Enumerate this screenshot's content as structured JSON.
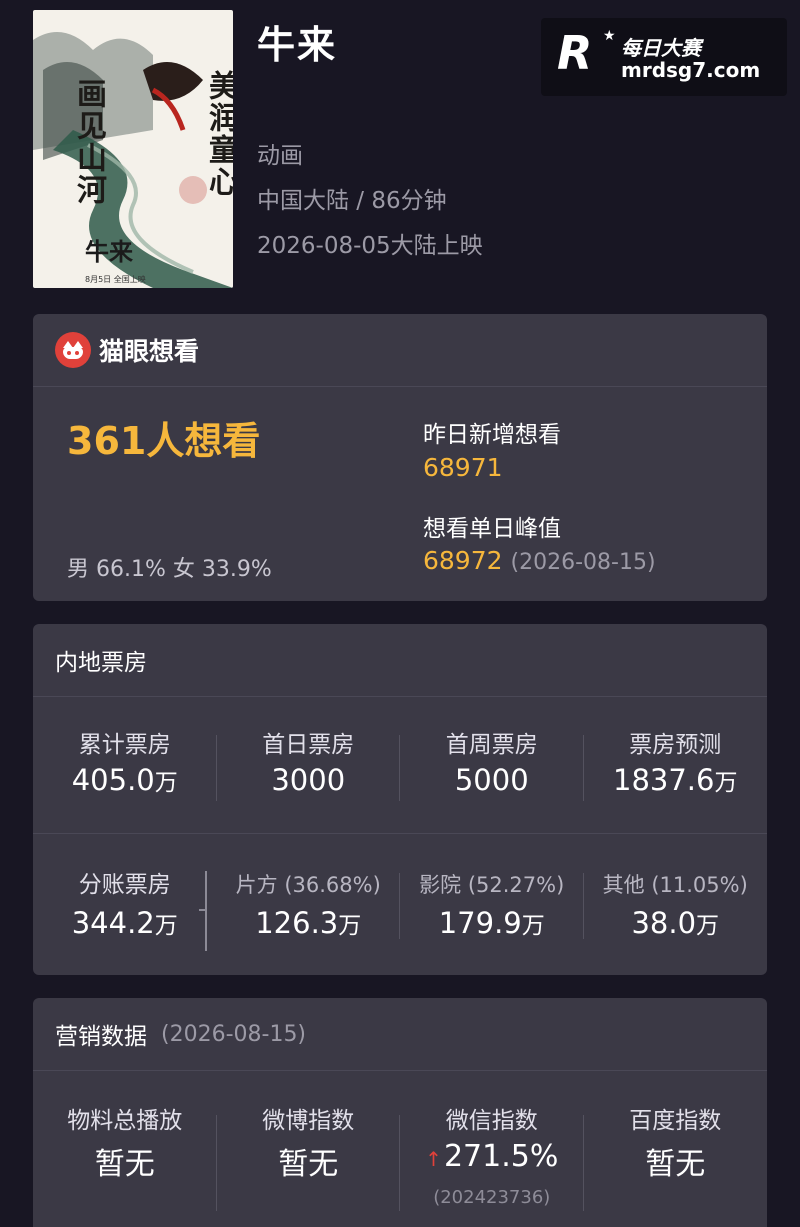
{
  "header": {
    "title": "牛来",
    "genre": "动画",
    "region_duration": "中国大陆 / 86分钟",
    "release": "2026-08-05大陆上映",
    "poster": {
      "left_text": "画见山河",
      "right_text": "美润童心",
      "title": "牛来",
      "date_line": "8月5日  全国上映"
    }
  },
  "watermark": {
    "logo": "R",
    "name": "每日大赛",
    "url": "mrdsg7.com"
  },
  "maoyan": {
    "brand": "猫眼想看",
    "want_count": "361人想看",
    "gender": "男 66.1% 女 33.9%",
    "yesterday_label": "昨日新增想看",
    "yesterday_value": "68971",
    "peak_label": "想看单日峰值",
    "peak_value": "68972",
    "peak_date": "(2026-08-15)"
  },
  "box_office": {
    "title": "内地票房",
    "row1": [
      {
        "label": "累计票房",
        "value": "405.0",
        "unit": "万"
      },
      {
        "label": "首日票房",
        "value": "3000",
        "unit": ""
      },
      {
        "label": "首周票房",
        "value": "5000",
        "unit": ""
      },
      {
        "label": "票房预测",
        "value": "1837.6",
        "unit": "万"
      }
    ],
    "row2": [
      {
        "label": "分账票房",
        "value": "344.2",
        "unit": "万"
      },
      {
        "label": "片方 (36.68%)",
        "value": "126.3",
        "unit": "万"
      },
      {
        "label": "影院 (52.27%)",
        "value": "179.9",
        "unit": "万"
      },
      {
        "label": "其他 (11.05%)",
        "value": "38.0",
        "unit": "万"
      }
    ]
  },
  "marketing": {
    "title": "营销数据",
    "date": "(2026-08-15)",
    "items": [
      {
        "label": "物料总播放",
        "value": "暂无"
      },
      {
        "label": "微博指数",
        "value": "暂无"
      },
      {
        "label": "微信指数",
        "value": "271.5%",
        "sub": "(202423736)"
      },
      {
        "label": "百度指数",
        "value": "暂无"
      }
    ]
  },
  "colors": {
    "accent": "#f6b73c",
    "brand_red": "#e0413a",
    "card_bg": "#3b3945",
    "page_bg": "#181623"
  },
  "icons": [
    "maoyan-cat-icon",
    "arrow-up-icon"
  ]
}
